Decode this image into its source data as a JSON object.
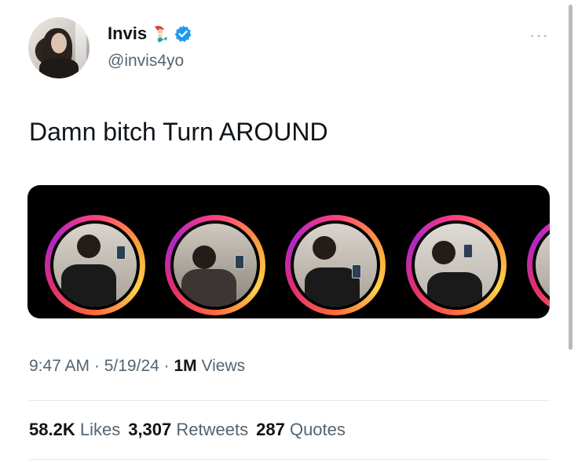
{
  "author": {
    "display_name": "Invis",
    "handle": "@invis4yo",
    "emoji_icon": "mermaid-emoji-icon",
    "verified_icon": "verified-badge-icon",
    "verified_color": "#1d9bf0"
  },
  "tweet": {
    "text": "Damn bitch Turn AROUND",
    "media": {
      "type": "image",
      "description_icons": [
        "story-ring",
        "story-ring",
        "story-ring",
        "story-ring",
        "story-ring"
      ]
    }
  },
  "meta": {
    "time": "9:47 AM",
    "date": "5/19/24",
    "views_count": "1M",
    "views_label": "Views"
  },
  "stats": [
    {
      "count": "58.2K",
      "label": "Likes"
    },
    {
      "count": "3,307",
      "label": "Retweets"
    },
    {
      "count": "287",
      "label": "Quotes"
    }
  ],
  "more_menu_icon": "more-dots-icon"
}
